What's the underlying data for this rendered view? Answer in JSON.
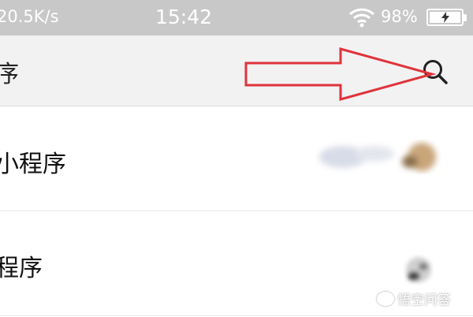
{
  "status_bar": {
    "network_speed": "20.5K/s",
    "time": "15:42",
    "battery_percent": "98%",
    "icons": [
      "wifi-icon",
      "battery-icon",
      "charging-bolt-icon"
    ]
  },
  "app_bar": {
    "title": "序",
    "search_icon": "search-icon"
  },
  "list": {
    "items": [
      {
        "label": "小程序"
      },
      {
        "label": "程序"
      }
    ]
  },
  "watermark": {
    "text": "悟空问答"
  },
  "colors": {
    "status_bar_bg": "#c8c8c8",
    "app_bar_bg": "#f2f2f2",
    "annotation_red": "#e0333c"
  }
}
